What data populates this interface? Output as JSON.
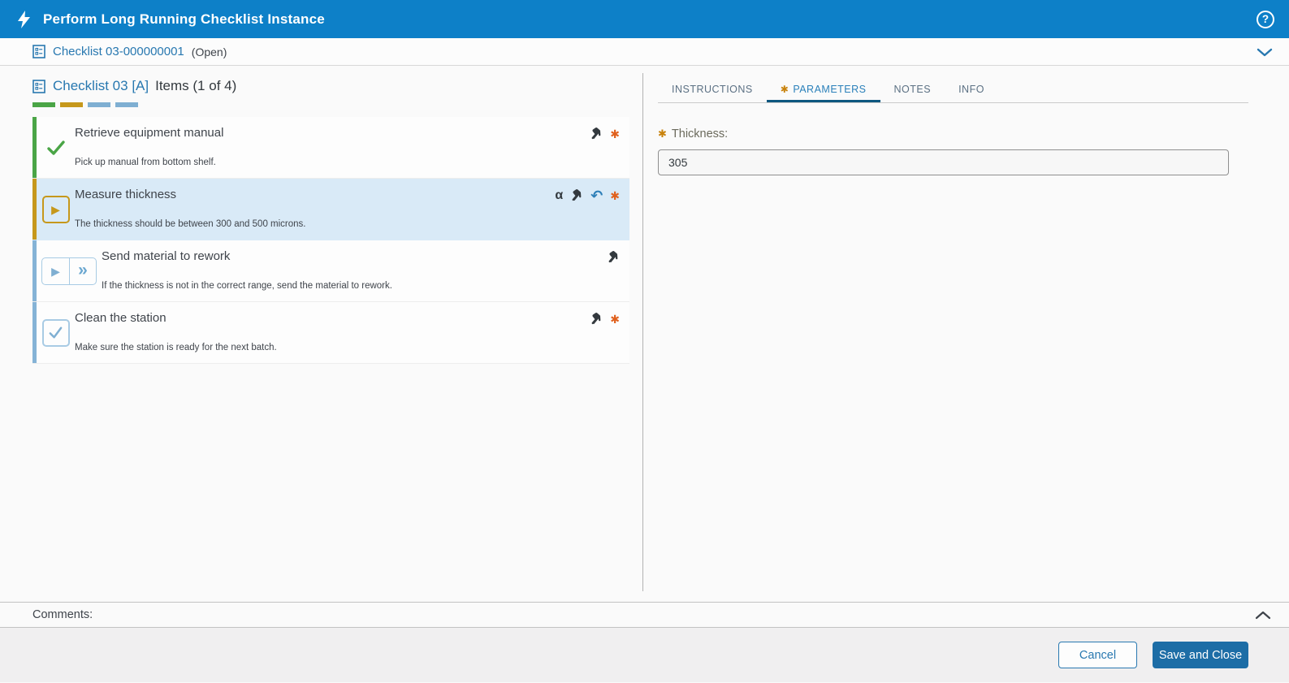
{
  "header": {
    "title": "Perform Long Running Checklist Instance",
    "help_glyph": "?"
  },
  "context_bar": {
    "link": "Checklist 03-000000001",
    "status": "(Open)"
  },
  "left_panel": {
    "title": "Checklist 03 [A]",
    "items_label": "Items (1 of 4)",
    "progress_segment_colors": [
      "#4aa546",
      "#c6981b",
      "#7fafd2",
      "#7fafd2"
    ],
    "items": [
      {
        "title": "Retrieve equipment manual",
        "description": "Pick up manual from bottom shelf.",
        "status": "completed",
        "required": true,
        "selected": false
      },
      {
        "title": "Measure thickness",
        "description": "The thickness should be between 300 and 500 microns.",
        "status": "in-progress",
        "required": true,
        "selected": true
      },
      {
        "title": "Send material to rework",
        "description": "If the thickness is not in the correct range, send the material to rework.",
        "status": "pending",
        "required": false,
        "selected": false
      },
      {
        "title": "Clean the station",
        "description": "Make sure the station is ready for the next batch.",
        "status": "pending",
        "required": true,
        "selected": false
      }
    ]
  },
  "right_panel": {
    "tabs": [
      {
        "label": "INSTRUCTIONS",
        "selected": false,
        "required": false
      },
      {
        "label": "PARAMETERS",
        "selected": true,
        "required": true
      },
      {
        "label": "NOTES",
        "selected": false,
        "required": false
      },
      {
        "label": "INFO",
        "selected": false,
        "required": false
      }
    ],
    "parameters": [
      {
        "label": "Thickness:",
        "value": "305",
        "required": true
      }
    ]
  },
  "comments": {
    "label": "Comments:"
  },
  "footer": {
    "cancel": "Cancel",
    "save": "Save and Close"
  },
  "icons": {
    "play": "▶",
    "skip": "»",
    "undo": "↶",
    "alpha": "α",
    "required_star": "✱"
  },
  "colors": {
    "header_bg": "#0d80c8",
    "link_blue": "#2878b0",
    "selected_row_bg": "#d9eaf7",
    "done_green": "#4aa546",
    "current_gold": "#c6981b",
    "pending_blue": "#7fafd2",
    "required_orange": "#e0611e",
    "tab_star_amber": "#c8820c",
    "tab_underline": "#0d577f",
    "save_button_bg": "#1d6da6"
  }
}
